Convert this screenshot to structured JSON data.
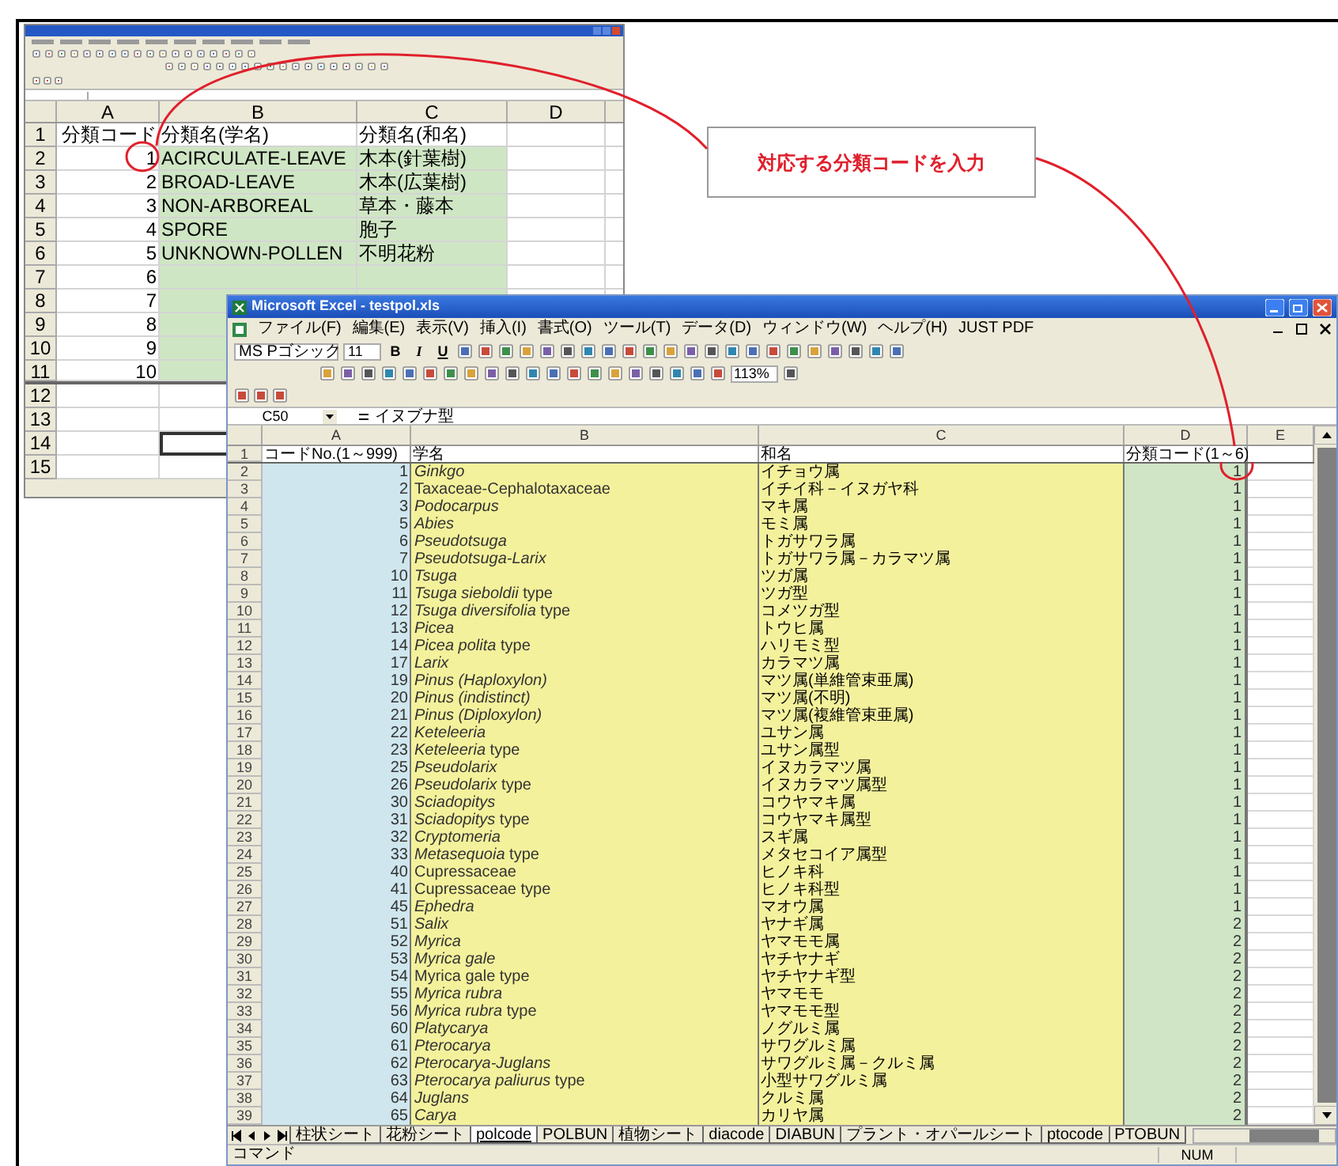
{
  "callout": {
    "text": "対応する分類コードを入力"
  },
  "back_window": {
    "columns": [
      "A",
      "B",
      "C",
      "D"
    ],
    "rows": [
      {
        "row": "1",
        "code": "分類コード",
        "sci": "分類名(学名)",
        "jp": "分類名(和名)",
        "highlighted": false,
        "b_selected": false
      },
      {
        "row": "2",
        "code": "1",
        "sci": "ACIRCULATE-LEAVE",
        "jp": "木本(針葉樹)",
        "highlighted": true,
        "b_selected": false
      },
      {
        "row": "3",
        "code": "2",
        "sci": "BROAD-LEAVE",
        "jp": "木本(広葉樹)",
        "highlighted": true,
        "b_selected": false
      },
      {
        "row": "4",
        "code": "3",
        "sci": "NON-ARBOREAL",
        "jp": "草本・藤本",
        "highlighted": true,
        "b_selected": false
      },
      {
        "row": "5",
        "code": "4",
        "sci": "SPORE",
        "jp": "胞子",
        "highlighted": true,
        "b_selected": false
      },
      {
        "row": "6",
        "code": "5",
        "sci": "UNKNOWN-POLLEN",
        "jp": "不明花粉",
        "highlighted": true,
        "b_selected": false
      },
      {
        "row": "7",
        "code": "6",
        "highlighted": true,
        "b_selected": false
      },
      {
        "row": "8",
        "code": "7",
        "highlighted": true,
        "b_selected": false
      },
      {
        "row": "9",
        "code": "8",
        "highlighted": true,
        "b_selected": false
      },
      {
        "row": "10",
        "code": "9",
        "highlighted": true,
        "b_selected": false
      },
      {
        "row": "11",
        "code": "10",
        "highlighted": true,
        "b_selected": false
      },
      {
        "row": "12",
        "highlighted": false,
        "b_selected": false
      },
      {
        "row": "13",
        "highlighted": false,
        "b_selected": false
      },
      {
        "row": "14",
        "highlighted": false,
        "b_selected": true
      },
      {
        "row": "15",
        "highlighted": false,
        "b_selected": false
      }
    ]
  },
  "front_window": {
    "title": "Microsoft Excel - testpol.xls",
    "menu": [
      "ファイル(F)",
      "編集(E)",
      "表示(V)",
      "挿入(I)",
      "書式(O)",
      "ツール(T)",
      "データ(D)",
      "ウィンドウ(W)",
      "ヘルプ(H)",
      "JUST PDF"
    ],
    "font": "MS Pゴシック",
    "font_size": "11",
    "format_buttons": [
      "B",
      "I",
      "U"
    ],
    "zoom": "113%",
    "name_box": "C50",
    "formula": "イヌブナ型",
    "columns": [
      "A",
      "B",
      "C",
      "D",
      "E"
    ],
    "header_row": {
      "row": "1",
      "a": "コードNo.(1～999)",
      "b": "学名",
      "c": "和名",
      "d": "分類コード(1～6)"
    },
    "rows": [
      {
        "row": "2",
        "code": "1",
        "name": "Ginkgo",
        "italic": true,
        "jp": "イチョウ属",
        "class": "1"
      },
      {
        "row": "3",
        "code": "2",
        "name": "Taxaceae-Cephalotaxaceae",
        "italic": false,
        "jp": "イチイ科－イヌガヤ科",
        "class": "1"
      },
      {
        "row": "4",
        "code": "3",
        "name": "Podocarpus",
        "italic": true,
        "jp": "マキ属",
        "class": "1"
      },
      {
        "row": "5",
        "code": "5",
        "name": "Abies",
        "italic": true,
        "jp": "モミ属",
        "class": "1"
      },
      {
        "row": "6",
        "code": "6",
        "name": "Pseudotsuga",
        "italic": true,
        "jp": "トガサワラ属",
        "class": "1"
      },
      {
        "row": "7",
        "code": "7",
        "name": "Pseudotsuga-Larix",
        "italic": true,
        "jp": "トガサワラ属－カラマツ属",
        "class": "1"
      },
      {
        "row": "8",
        "code": "10",
        "name": "Tsuga",
        "italic": true,
        "jp": "ツガ属",
        "class": "1"
      },
      {
        "row": "9",
        "code": "11",
        "name": "*Tsuga sieboldii* type",
        "italic": false,
        "jp": "ツガ型",
        "class": "1"
      },
      {
        "row": "10",
        "code": "12",
        "name": "*Tsuga diversifolia* type",
        "italic": false,
        "jp": "コメツガ型",
        "class": "1"
      },
      {
        "row": "11",
        "code": "13",
        "name": "Picea",
        "italic": true,
        "jp": "トウヒ属",
        "class": "1"
      },
      {
        "row": "12",
        "code": "14",
        "name": "*Picea polita* type",
        "italic": false,
        "jp": "ハリモミ型",
        "class": "1"
      },
      {
        "row": "13",
        "code": "17",
        "name": "Larix",
        "italic": true,
        "jp": "カラマツ属",
        "class": "1"
      },
      {
        "row": "14",
        "code": "19",
        "name": "Pinus (Haploxylon)",
        "italic": true,
        "jp": "マツ属(単維管束亜属)",
        "class": "1"
      },
      {
        "row": "15",
        "code": "20",
        "name": "Pinus (indistinct)",
        "italic": true,
        "jp": "マツ属(不明)",
        "class": "1"
      },
      {
        "row": "16",
        "code": "21",
        "name": "Pinus (Diploxylon)",
        "italic": true,
        "jp": "マツ属(複維管束亜属)",
        "class": "1"
      },
      {
        "row": "17",
        "code": "22",
        "name": "Keteleeria",
        "italic": true,
        "jp": "ユサン属",
        "class": "1"
      },
      {
        "row": "18",
        "code": "23",
        "name": "*Keteleeria* type",
        "italic": false,
        "jp": "ユサン属型",
        "class": "1"
      },
      {
        "row": "19",
        "code": "25",
        "name": "Pseudolarix",
        "italic": true,
        "jp": "イヌカラマツ属",
        "class": "1"
      },
      {
        "row": "20",
        "code": "26",
        "name": "*Pseudolarix* type",
        "italic": false,
        "jp": "イヌカラマツ属型",
        "class": "1"
      },
      {
        "row": "21",
        "code": "30",
        "name": "Sciadopitys",
        "italic": true,
        "jp": "コウヤマキ属",
        "class": "1"
      },
      {
        "row": "22",
        "code": "31",
        "name": "*Sciadopitys* type",
        "italic": false,
        "jp": "コウヤマキ属型",
        "class": "1"
      },
      {
        "row": "23",
        "code": "32",
        "name": "Cryptomeria",
        "italic": true,
        "jp": "スギ属",
        "class": "1"
      },
      {
        "row": "24",
        "code": "33",
        "name": "*Metasequoia* type",
        "italic": false,
        "jp": "メタセコイア属型",
        "class": "1"
      },
      {
        "row": "25",
        "code": "40",
        "name": "Cupressaceae",
        "italic": false,
        "jp": "ヒノキ科",
        "class": "1"
      },
      {
        "row": "26",
        "code": "41",
        "name": "Cupressaceae type",
        "italic": false,
        "jp": "ヒノキ科型",
        "class": "1"
      },
      {
        "row": "27",
        "code": "45",
        "name": "Ephedra",
        "italic": true,
        "jp": "マオウ属",
        "class": "1"
      },
      {
        "row": "28",
        "code": "51",
        "name": "Salix",
        "italic": true,
        "jp": "ヤナギ属",
        "class": "2"
      },
      {
        "row": "29",
        "code": "52",
        "name": "Myrica",
        "italic": true,
        "jp": "ヤマモモ属",
        "class": "2"
      },
      {
        "row": "30",
        "code": "53",
        "name": "Myrica gale",
        "italic": true,
        "jp": "ヤチヤナギ",
        "class": "2"
      },
      {
        "row": "31",
        "code": "54",
        "name": "Myrica gale type",
        "italic": false,
        "jp": "ヤチヤナギ型",
        "class": "2"
      },
      {
        "row": "32",
        "code": "55",
        "name": "Myrica rubra",
        "italic": true,
        "jp": "ヤマモモ",
        "class": "2"
      },
      {
        "row": "33",
        "code": "56",
        "name": "*Myrica rubra* type",
        "italic": false,
        "jp": "ヤマモモ型",
        "class": "2"
      },
      {
        "row": "34",
        "code": "60",
        "name": "Platycarya",
        "italic": true,
        "jp": "ノグルミ属",
        "class": "2"
      },
      {
        "row": "35",
        "code": "61",
        "name": "Pterocarya",
        "italic": true,
        "jp": "サワグルミ属",
        "class": "2"
      },
      {
        "row": "36",
        "code": "62",
        "name": "Pterocarya-Juglans",
        "italic": true,
        "jp": "サワグルミ属－クルミ属",
        "class": "2"
      },
      {
        "row": "37",
        "code": "63",
        "name": "*Pterocarya paliurus* type",
        "italic": false,
        "jp": "小型サワグルミ属",
        "class": "2"
      },
      {
        "row": "38",
        "code": "64",
        "name": "Juglans",
        "italic": true,
        "jp": "クルミ属",
        "class": "2"
      },
      {
        "row": "39",
        "code": "65",
        "name": "Carya",
        "italic": true,
        "jp": "カリヤ属",
        "class": "2"
      }
    ],
    "tabs": [
      {
        "label": "柱状シート",
        "selected": false
      },
      {
        "label": "花粉シート",
        "selected": false
      },
      {
        "label": "polcode",
        "selected": true
      },
      {
        "label": "POLBUN",
        "selected": false
      },
      {
        "label": "植物シート",
        "selected": false
      },
      {
        "label": "diacode",
        "selected": false
      },
      {
        "label": "DIABUN",
        "selected": false
      },
      {
        "label": "プラント・オパールシート",
        "selected": false
      },
      {
        "label": "ptocode",
        "selected": false
      },
      {
        "label": "PTOBUN",
        "selected": false
      }
    ],
    "status": {
      "mode": "コマンド",
      "indicator": "NUM"
    }
  }
}
